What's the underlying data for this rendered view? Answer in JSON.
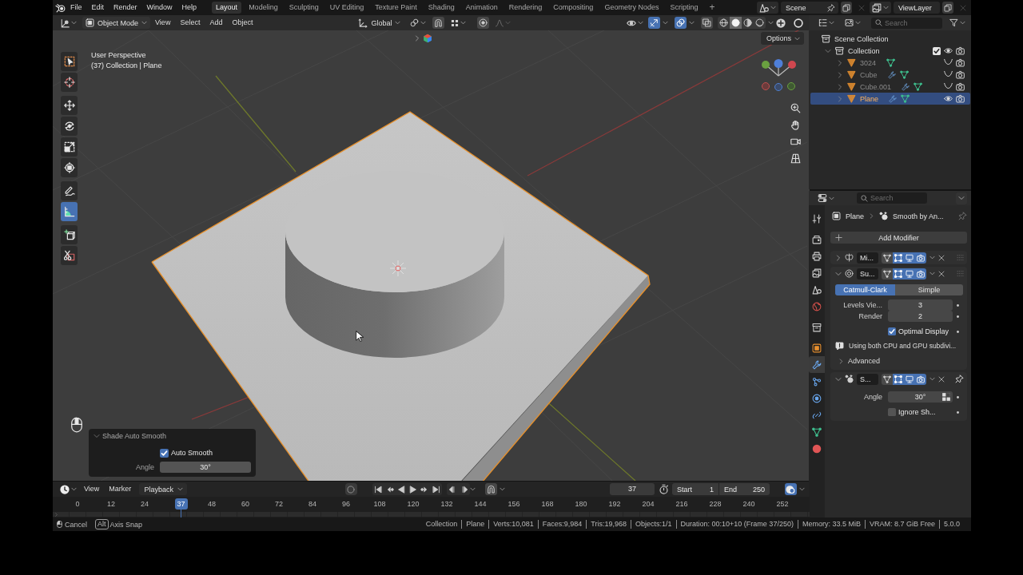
{
  "topbar": {
    "menus": [
      "File",
      "Edit",
      "Render",
      "Window",
      "Help"
    ],
    "workspaces": [
      {
        "label": "Layout",
        "selected": true
      },
      {
        "label": "Modeling",
        "selected": false
      },
      {
        "label": "Sculpting",
        "selected": false
      },
      {
        "label": "UV Editing",
        "selected": false
      },
      {
        "label": "Texture Paint",
        "selected": false
      },
      {
        "label": "Shading",
        "selected": false
      },
      {
        "label": "Animation",
        "selected": false
      },
      {
        "label": "Rendering",
        "selected": false
      },
      {
        "label": "Compositing",
        "selected": false
      },
      {
        "label": "Geometry Nodes",
        "selected": false
      },
      {
        "label": "Scripting",
        "selected": false
      }
    ],
    "add_workspace": "+",
    "scene": "Scene",
    "view_layer": "ViewLayer"
  },
  "viewport": {
    "header": {
      "mode": "Object Mode",
      "menus": [
        "View",
        "Select",
        "Add",
        "Object"
      ],
      "orientation": "Global",
      "snapping": false,
      "proportional_editing": false,
      "gizmos": true,
      "overlays": true,
      "xray": false,
      "shading": [
        {
          "kind": "wireframe",
          "selected": false
        },
        {
          "kind": "solid",
          "selected": true
        },
        {
          "kind": "material",
          "selected": false
        },
        {
          "kind": "rendered",
          "selected": false
        }
      ]
    },
    "options": "Options",
    "info": [
      "User Perspective",
      "(37) Collection | Plane"
    ],
    "tools": [
      {
        "kind": "select-box",
        "selected": false
      },
      {
        "kind": "cursor",
        "selected": false
      },
      {
        "kind": "move",
        "selected": false
      },
      {
        "kind": "rotate",
        "selected": false
      },
      {
        "kind": "scale",
        "selected": false
      },
      {
        "kind": "transform",
        "selected": false
      },
      {
        "kind": "annotate",
        "selected": false
      },
      {
        "kind": "measure",
        "selected": true
      },
      {
        "kind": "add-cube",
        "selected": false
      },
      {
        "kind": "knife",
        "selected": false
      }
    ],
    "operator_panel": {
      "title": "Shade Auto Smooth",
      "expanded": true,
      "auto_smooth": {
        "label": "Auto Smooth",
        "checked": true
      },
      "angle": {
        "label": "Angle",
        "value": "30°"
      }
    }
  },
  "timeline": {
    "menus": [
      "View",
      "Marker"
    ],
    "playback": "Playback",
    "auto_keying": false,
    "snapping": false,
    "current_frame": "37",
    "start": {
      "label": "Start",
      "value": "1"
    },
    "end": {
      "label": "End",
      "value": "250"
    },
    "sync": true,
    "ruler": [
      "0",
      "12",
      "24",
      "48",
      "60",
      "72",
      "84",
      "96",
      "108",
      "120",
      "132",
      "144",
      "156",
      "168",
      "180",
      "192",
      "204",
      "216",
      "228",
      "240",
      "252"
    ],
    "playhead": "37"
  },
  "outliner": {
    "search": {
      "placeholder": "Search"
    },
    "root": "Scene Collection",
    "collections": [
      {
        "kind": "collection",
        "label": "Collection",
        "expanded": true,
        "selected": false,
        "checked": true,
        "visible": true,
        "children": [
          {
            "kind": "mesh",
            "label": "3024",
            "expanded": false,
            "selected": false,
            "visible": false,
            "has_modifiers": false
          },
          {
            "kind": "mesh",
            "label": "Cube",
            "expanded": false,
            "selected": false,
            "visible": false,
            "has_modifiers": true
          },
          {
            "kind": "mesh",
            "label": "Cube.001",
            "expanded": false,
            "selected": false,
            "visible": false,
            "has_modifiers": true
          },
          {
            "kind": "mesh",
            "label": "Plane",
            "expanded": false,
            "selected": true,
            "visible": true,
            "has_modifiers": true
          }
        ]
      }
    ]
  },
  "properties": {
    "search": {
      "placeholder": "Search"
    },
    "tabs": [
      {
        "kind": "tool",
        "selected": false
      },
      {
        "kind": "render",
        "selected": false
      },
      {
        "kind": "output",
        "selected": false
      },
      {
        "kind": "view-layer",
        "selected": false
      },
      {
        "kind": "scene",
        "selected": false
      },
      {
        "kind": "world",
        "selected": false
      },
      {
        "kind": "collection",
        "selected": false
      },
      {
        "kind": "object",
        "selected": false
      },
      {
        "kind": "modifiers",
        "selected": true
      },
      {
        "kind": "particles",
        "selected": false
      },
      {
        "kind": "physics",
        "selected": false
      },
      {
        "kind": "constraints",
        "selected": false
      },
      {
        "kind": "data",
        "selected": false
      },
      {
        "kind": "material",
        "selected": false
      }
    ],
    "breadcrumb": [
      {
        "kind": "object",
        "label": "Plane"
      },
      {
        "kind": "modifier",
        "label": "Smooth by An..."
      }
    ],
    "add_modifier": "Add Modifier",
    "modifiers": [
      {
        "kind": "mirror",
        "name": "Mi...",
        "expanded": false,
        "pinned": false,
        "toggles": [
          {
            "kind": "on-cage",
            "on": false
          },
          {
            "kind": "edit-mode",
            "on": true
          },
          {
            "kind": "viewport",
            "on": true
          },
          {
            "kind": "render",
            "on": true
          }
        ]
      },
      {
        "kind": "subdivision",
        "name": "Su...",
        "expanded": true,
        "pinned": false,
        "toggles": [
          {
            "kind": "on-cage",
            "on": false
          },
          {
            "kind": "edit-mode",
            "on": true
          },
          {
            "kind": "viewport",
            "on": true
          },
          {
            "kind": "render",
            "on": true
          }
        ],
        "methods": [
          {
            "label": "Catmull-Clark",
            "selected": true
          },
          {
            "label": "Simple",
            "selected": false
          }
        ],
        "fields": [
          {
            "label": "Levels Vie...",
            "value": "3"
          },
          {
            "label": "Render",
            "value": "2"
          }
        ],
        "optimal_display": {
          "label": "Optimal Display",
          "checked": true
        },
        "info": "Using both CPU and GPU subdivi...",
        "advanced": {
          "label": "Advanced",
          "expanded": false
        }
      },
      {
        "kind": "smooth-by-angle",
        "name": "S...",
        "expanded": true,
        "pinned": true,
        "toggles": [
          {
            "kind": "on-cage",
            "on": false
          },
          {
            "kind": "edit-mode",
            "on": true
          },
          {
            "kind": "viewport",
            "on": true
          },
          {
            "kind": "render",
            "on": true
          }
        ],
        "angle": {
          "label": "Angle",
          "value": "30°"
        },
        "ignore_sharp": {
          "label": "Ignore Sh...",
          "checked": false
        }
      }
    ]
  },
  "status_bar": {
    "hints": [
      {
        "kind": "mouse",
        "label": "Cancel"
      },
      {
        "kind": "key",
        "key": "Alt",
        "label": "Axis Snap"
      }
    ],
    "stats": [
      "Collection",
      "Plane",
      "Verts:10,081",
      "Faces:9,984",
      "Tris:19,968",
      "Objects:1/1",
      "Duration: 00:10+10 (Frame 37/250)",
      "Memory: 33.5 MiB",
      "VRAM: 8.7 GiB Free",
      "5.0.0"
    ]
  }
}
